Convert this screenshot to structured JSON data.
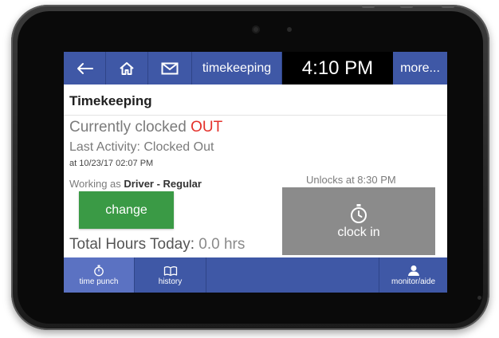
{
  "topbar": {
    "back_icon": "arrow-left-icon",
    "home_icon": "home-icon",
    "mail_icon": "envelope-icon",
    "title": "timekeeping",
    "time": "4:10 PM",
    "more": "more..."
  },
  "section": {
    "title": "Timekeeping"
  },
  "status": {
    "prefix": "Currently clocked ",
    "value": "OUT",
    "value_color": "#e4312b"
  },
  "activity": {
    "last": "Last Activity: Clocked Out",
    "timestamp": "at 10/23/17 02:07 PM"
  },
  "working": {
    "prefix": "Working as ",
    "role": "Driver - Regular"
  },
  "change_button": {
    "label": "change",
    "color": "#3a9a45"
  },
  "total": {
    "label": "Total Hours Today:",
    "value": "0.0 hrs"
  },
  "clock": {
    "unlocks": "Unlocks at 8:30 PM",
    "button_label": "clock in",
    "icon": "stopwatch-icon"
  },
  "bottombar": {
    "time_punch": "time punch",
    "history": "history",
    "monitor": "monitor/aide",
    "time_punch_icon": "stopwatch-icon",
    "history_icon": "book-icon",
    "monitor_icon": "person-icon"
  },
  "colors": {
    "nav_blue": "#3f58a6",
    "nav_active": "#5b72c2",
    "clock_button": "#8b8b8b"
  }
}
